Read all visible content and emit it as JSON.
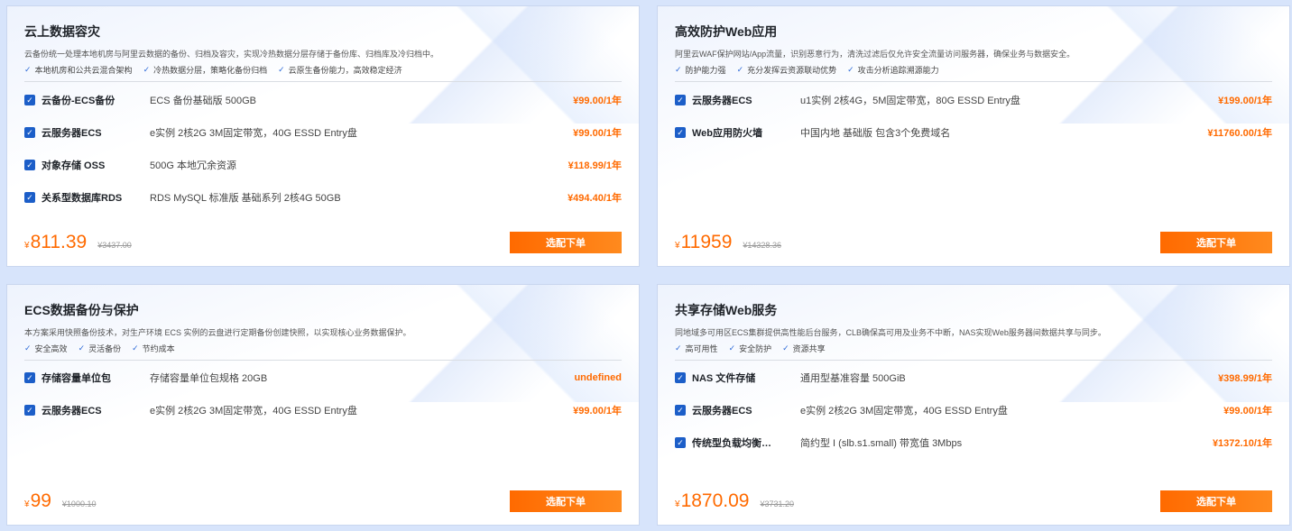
{
  "cards": [
    {
      "title": "云上数据容灾",
      "desc": "云备份统一处理本地机房与阿里云数据的备份、归档及容灾，实现冷热数据分层存储于备份库、归档库及冷归档中。",
      "features": [
        "本地机房和公共云混合架构",
        "冷热数据分层，策略化备份归档",
        "云原生备份能力，高效稳定经济"
      ],
      "items": [
        {
          "name": "云备份-ECS备份",
          "spec": "ECS 备份基础版 500GB",
          "price": "¥99.00/1年"
        },
        {
          "name": "云服务器ECS",
          "spec": "e实例 2核2G 3M固定带宽，40G ESSD Entry盘",
          "price": "¥99.00/1年"
        },
        {
          "name": "对象存储 OSS",
          "spec": "500G 本地冗余资源",
          "price": "¥118.99/1年"
        },
        {
          "name": "关系型数据库RDS",
          "spec": "RDS MySQL 标准版 基础系列 2核4G 50GB",
          "price": "¥494.40/1年"
        }
      ],
      "currency": "¥",
      "total": "811.39",
      "original": "¥3437.00",
      "button": "选配下单"
    },
    {
      "title": "高效防护Web应用",
      "desc": "阿里云WAF保护网站/App流量，识别恶意行为，清洗过滤后仅允许安全流量访问服务器，确保业务与数据安全。",
      "features": [
        "防护能力强",
        "充分发挥云资源联动优势",
        "攻击分析追踪溯源能力"
      ],
      "items": [
        {
          "name": "云服务器ECS",
          "spec": "u1实例 2核4G，5M固定带宽，80G ESSD Entry盘",
          "price": "¥199.00/1年"
        },
        {
          "name": "Web应用防火墙",
          "spec": "中国内地 基础版 包含3个免费域名",
          "price": "¥11760.00/1年"
        }
      ],
      "currency": "¥",
      "total": "11959",
      "original": "¥14328.36",
      "button": "选配下单"
    },
    {
      "title": "ECS数据备份与保护",
      "desc": "本方案采用快照备份技术，对生产环境 ECS 实例的云盘进行定期备份创建快照，以实现核心业务数据保护。",
      "features": [
        "安全高效",
        "灵活备份",
        "节约成本"
      ],
      "items": [
        {
          "name": "存储容量单位包",
          "spec": "存储容量单位包规格 20GB",
          "price": "undefined"
        },
        {
          "name": "云服务器ECS",
          "spec": "e实例 2核2G 3M固定带宽，40G ESSD Entry盘",
          "price": "¥99.00/1年"
        }
      ],
      "currency": "¥",
      "total": "99",
      "original": "¥1000.10",
      "button": "选配下单"
    },
    {
      "title": "共享存储Web服务",
      "desc": "同地域多可用区ECS集群提供高性能后台服务，CLB确保高可用及业务不中断，NAS实现Web服务器间数据共享与同步。",
      "features": [
        "高可用性",
        "安全防护",
        "资源共享"
      ],
      "items": [
        {
          "name": "NAS 文件存储",
          "spec": "通用型基准容量 500GiB",
          "price": "¥398.99/1年"
        },
        {
          "name": "云服务器ECS",
          "spec": "e实例 2核2G 3M固定带宽，40G ESSD Entry盘",
          "price": "¥99.00/1年"
        },
        {
          "name": "传统型负载均衡…",
          "spec": "简约型 I (slb.s1.small) 带宽值 3Mbps",
          "price": "¥1372.10/1年"
        }
      ],
      "currency": "¥",
      "total": "1870.09",
      "original": "¥3731.20",
      "button": "选配下单"
    }
  ]
}
